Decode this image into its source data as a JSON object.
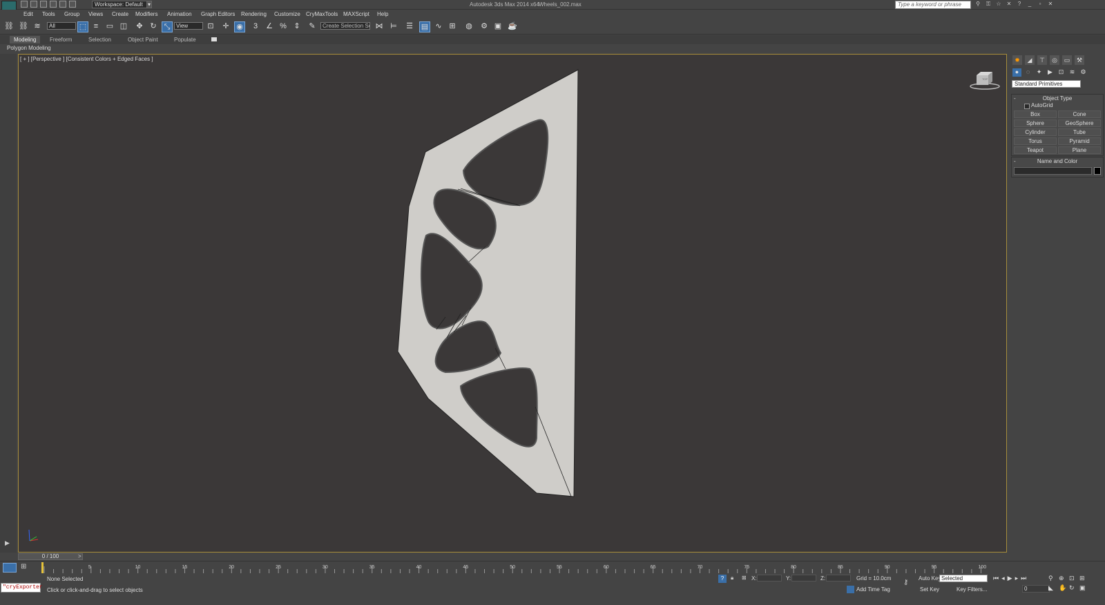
{
  "titlebar": {
    "workspace": "Workspace: Default",
    "app_title": "Autodesk 3ds Max  2014 x64",
    "file": "Wheels_002.max",
    "search_placeholder": "Type a keyword or phrase"
  },
  "menu": [
    "Edit",
    "Tools",
    "Group",
    "Views",
    "Create",
    "Modifiers",
    "Animation",
    "Graph Editors",
    "Rendering",
    "Customize",
    "CryMaxTools",
    "MAXScript",
    "Help"
  ],
  "toolbar": {
    "filter": "All",
    "ref_coord": "View",
    "named_selection": "Create Selection Se",
    "snap_label": "3"
  },
  "ribbon": {
    "tabs": [
      "Modeling",
      "Freeform",
      "Selection",
      "Object Paint",
      "Populate"
    ],
    "active": "Modeling",
    "sub": "Polygon Modeling"
  },
  "viewport": {
    "label": "[ + ] [Perspective ] [Consistent Colors + Edged Faces ]",
    "viewcube_face": "TOP"
  },
  "command_panel": {
    "category": "Standard Primitives",
    "object_type_title": "Object Type",
    "autogrid": "AutoGrid",
    "buttons": [
      "Box",
      "Cone",
      "Sphere",
      "GeoSphere",
      "Cylinder",
      "Tube",
      "Torus",
      "Pyramid",
      "Teapot",
      "Plane"
    ],
    "name_color_title": "Name and Color"
  },
  "trackbar": {
    "position": "0 / 100",
    "ticks": [
      "5",
      "10",
      "15",
      "20",
      "25",
      "30",
      "35",
      "40",
      "45",
      "50",
      "55",
      "60",
      "65",
      "70",
      "75",
      "80",
      "85",
      "90",
      "95",
      "100"
    ]
  },
  "status": {
    "maxscript": "\"cryExporter",
    "selection": "None Selected",
    "prompt": "Click or click-and-drag to select objects",
    "x_label": "X:",
    "y_label": "Y:",
    "z_label": "Z:",
    "grid": "Grid = 10.0cm",
    "add_time_tag": "Add Time Tag",
    "auto_key": "Auto Key",
    "set_key": "Set Key",
    "auto_key_mode": "Selected",
    "key_filters": "Key Filters...",
    "frame": "0"
  }
}
